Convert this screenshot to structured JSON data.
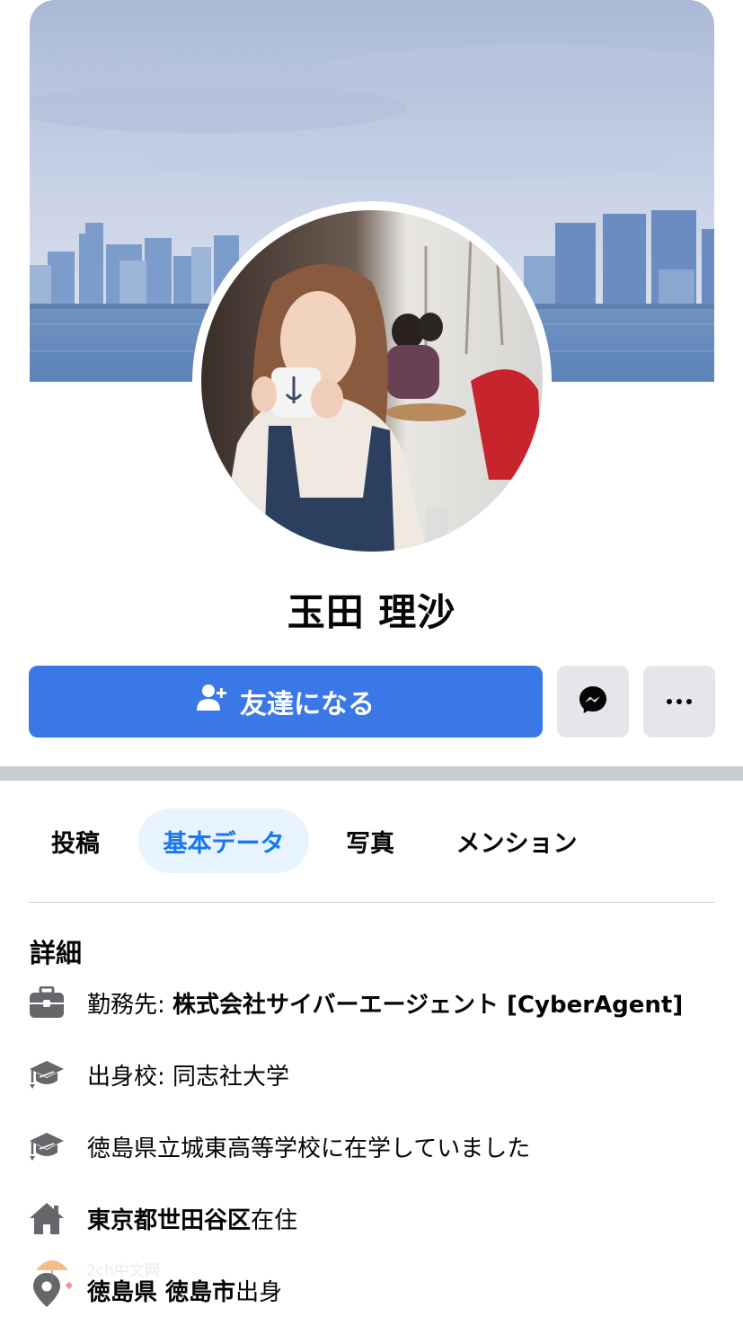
{
  "profile": {
    "name": "玉田 理沙"
  },
  "actions": {
    "add_friend_label": "友達になる",
    "messenger_icon": "messenger-icon",
    "more_icon": "more-dots-icon"
  },
  "tabs": [
    {
      "label": "投稿",
      "active": false
    },
    {
      "label": "基本データ",
      "active": true
    },
    {
      "label": "写真",
      "active": false
    },
    {
      "label": "メンション",
      "active": false
    }
  ],
  "details": {
    "title": "詳細",
    "work": {
      "prefix": "勤務先: ",
      "value": "株式会社サイバーエージェント [CyberAgent]",
      "icon": "briefcase-icon"
    },
    "college": {
      "prefix": "出身校: ",
      "value": "同志社大学",
      "icon": "graduation-cap-icon"
    },
    "high_school": {
      "value": "徳島県立城東高等学校に在学していました",
      "icon": "graduation-cap-icon"
    },
    "lives_in": {
      "value": "東京都世田谷区",
      "suffix": "在住",
      "icon": "home-icon"
    },
    "hometown": {
      "value": "徳島県 徳島市",
      "suffix": "出身",
      "icon": "location-pin-icon"
    }
  },
  "watermark": {
    "text": "2ch中文网"
  },
  "colors": {
    "primary": "#3b78e7",
    "tab_active_bg": "#e7f3ff",
    "tab_active_text": "#1877f2",
    "secondary_button": "#e4e6eb",
    "icon_gray": "#65676b"
  }
}
